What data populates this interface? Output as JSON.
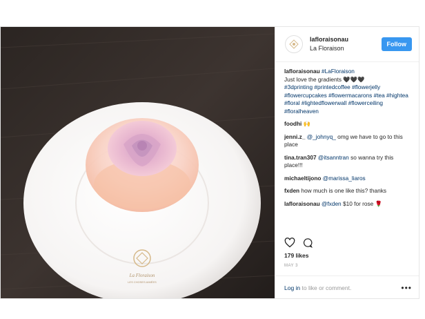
{
  "post": {
    "username": "lafloraisonau",
    "location": "La Floraison",
    "follow_label": "Follow",
    "avatar_alt": "La Floraison logo",
    "photo_desc": "rose jelly cake on white plate",
    "plate_brand": "La Floraison",
    "plate_tagline": "LES CHOSES AIMÉES"
  },
  "caption": {
    "username": "lafloraisonau",
    "parts": [
      {
        "text": "#LaFloraison",
        "type": "tag"
      },
      {
        "text": "Just love the gradients 🖤🖤🖤",
        "type": "text"
      },
      {
        "text": "#3dprinting #printedcoffee #flowerjelly #flowercupcakes #flowermacarons #tea #hightea #floral #lightedflowerwall #flowerceiling #floralheaven",
        "type": "tag"
      }
    ]
  },
  "comments": [
    {
      "user": "foodhi",
      "mention": "",
      "text": "🙌"
    },
    {
      "user": "jenni.z_",
      "mention": "@_johnyq_",
      "text": "omg we have to go to this place"
    },
    {
      "user": "tina.tran307",
      "mention": "@itsanntran",
      "text": "so wanna try this place!!!"
    },
    {
      "user": "michaeltijono",
      "mention": "@marissa_liaros",
      "text": ""
    },
    {
      "user": "fxden",
      "mention": "",
      "text": "how much is one like this? thanks"
    },
    {
      "user": "lafloraisonau",
      "mention": "@fxden",
      "text": "$10 for rose 🌹"
    }
  ],
  "actions": {
    "like_icon": "heart-outline-icon",
    "comment_icon": "comment-bubble-icon"
  },
  "likes": "179 likes",
  "date": "MAY 3",
  "footer": {
    "login": "Log in",
    "rest": " to like or comment.",
    "more_icon": "more-horizontal-icon"
  },
  "colors": {
    "accent": "#3897f0",
    "link": "#003569",
    "border": "#e6e6e6"
  }
}
